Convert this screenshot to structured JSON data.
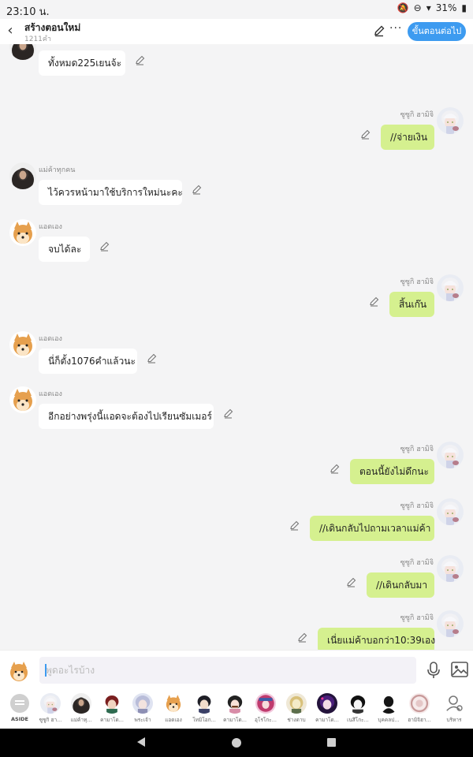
{
  "status": {
    "time": "23:10 น.",
    "battery": "31%"
  },
  "header": {
    "title": "สร้างตอนใหม่",
    "subtitle": "1211คำ",
    "next_label": "ขั้นตอนต่อไป"
  },
  "messages": [
    {
      "side": "left",
      "sender": "",
      "avatar": "hijab",
      "text": "ทั้งหมด225เยนจ้ะ"
    },
    {
      "side": "right",
      "sender": "ซูซูกิ ฮามิจิ",
      "avatar": "suzuki",
      "text": "//จ่ายเงิน"
    },
    {
      "side": "left",
      "sender": "แม่ค้าทุกคน",
      "avatar": "hijab",
      "text": "ไว้ควรหน้ามาใช้บริการใหม่นะคะ"
    },
    {
      "side": "left",
      "sender": "แอดเอง",
      "avatar": "shiba",
      "text": "จบได้ละ"
    },
    {
      "side": "right",
      "sender": "ซูซูกิ ฮามิจิ",
      "avatar": "suzuki",
      "text": "สิ้นเก๊น"
    },
    {
      "side": "left",
      "sender": "แอดเอง",
      "avatar": "shiba",
      "text": "นี่ก็ตั้ง1076คำแล้วนะ"
    },
    {
      "side": "left",
      "sender": "แอดเอง",
      "avatar": "shiba",
      "text": "อีกอย่างพรุ่งนี้แอดจะต้องไปเรียนซัมเมอร์"
    },
    {
      "side": "right",
      "sender": "ซูซูกิ ฮามิจิ",
      "avatar": "suzuki",
      "text": "ตอนนี้ยังไม่ดึกนะ"
    },
    {
      "side": "right",
      "sender": "ซูซูกิ ฮามิจิ",
      "avatar": "suzuki",
      "text": "//เดินกลับไปถามเวลาแม่ค้า"
    },
    {
      "side": "right",
      "sender": "ซูซูกิ ฮามิจิ",
      "avatar": "suzuki",
      "text": "//เดินกลับมา"
    },
    {
      "side": "right",
      "sender": "ซูซูกิ ฮามิจิ",
      "avatar": "suzuki",
      "text": "เนี่ยแม่ค้าบอกว่า10:39เอง"
    }
  ],
  "input": {
    "placeholder": "พูดอะไรบ้าง"
  },
  "characters": [
    {
      "name": "ASIDE",
      "kind": "aside"
    },
    {
      "name": "ซูซูกิ ฮา...",
      "kind": "suzuki"
    },
    {
      "name": "แม่ค้าทุ...",
      "kind": "hijab"
    },
    {
      "name": "คามาโด...",
      "kind": "red"
    },
    {
      "name": "พระเจ้า",
      "kind": "silver"
    },
    {
      "name": "แอดเอง",
      "kind": "shiba"
    },
    {
      "name": "โทมิโอก...",
      "kind": "dark"
    },
    {
      "name": "คามาโด...",
      "kind": "nezuko"
    },
    {
      "name": "อุโรโกะ...",
      "kind": "pink"
    },
    {
      "name": "ช่างดาบ",
      "kind": "mask"
    },
    {
      "name": "คามาโด...",
      "kind": "purple"
    },
    {
      "name": "เนสึโกะ...",
      "kind": "bw"
    },
    {
      "name": "บุคคลป...",
      "kind": "shadow"
    },
    {
      "name": "ฮามิจิฮา...",
      "kind": "floral"
    },
    {
      "name": "บริหาร",
      "kind": "manage"
    }
  ],
  "colors": {
    "accent": "#3d9bf0",
    "my_bubble": "#d5f08f",
    "other_bubble": "#ffffff"
  }
}
